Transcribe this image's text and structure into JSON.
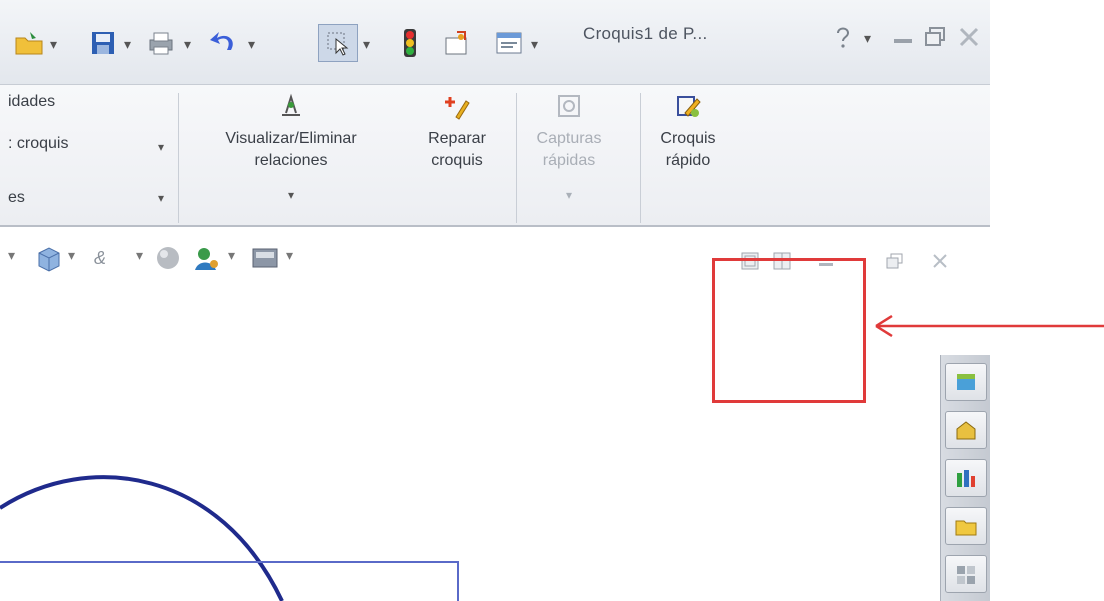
{
  "window": {
    "title": "Croquis1 de P...",
    "help_label": "?"
  },
  "ribbon": {
    "left_item_1": "idades",
    "left_item_2": ": croquis",
    "left_item_3": "es",
    "visualize_label_1": "Visualizar/Eliminar",
    "visualize_label_2": "relaciones",
    "repair_label_1": "Reparar",
    "repair_label_2": "croquis",
    "captures_label_1": "Capturas",
    "captures_label_2": "rápidas",
    "quick_sketch_label_1": "Croquis",
    "quick_sketch_label_2": "rápido"
  },
  "colors": {
    "annotation": "#e03a3a",
    "sketch_line": "#1f2a8c"
  },
  "icons": {
    "highlighted": "sketch-confirm-corner-icon",
    "quick_access": [
      "open-folder-icon",
      "save-icon",
      "print-icon",
      "undo-icon",
      "select-icon",
      "rebuild-traffic-light-icon",
      "options-icon",
      "file-properties-icon"
    ]
  }
}
